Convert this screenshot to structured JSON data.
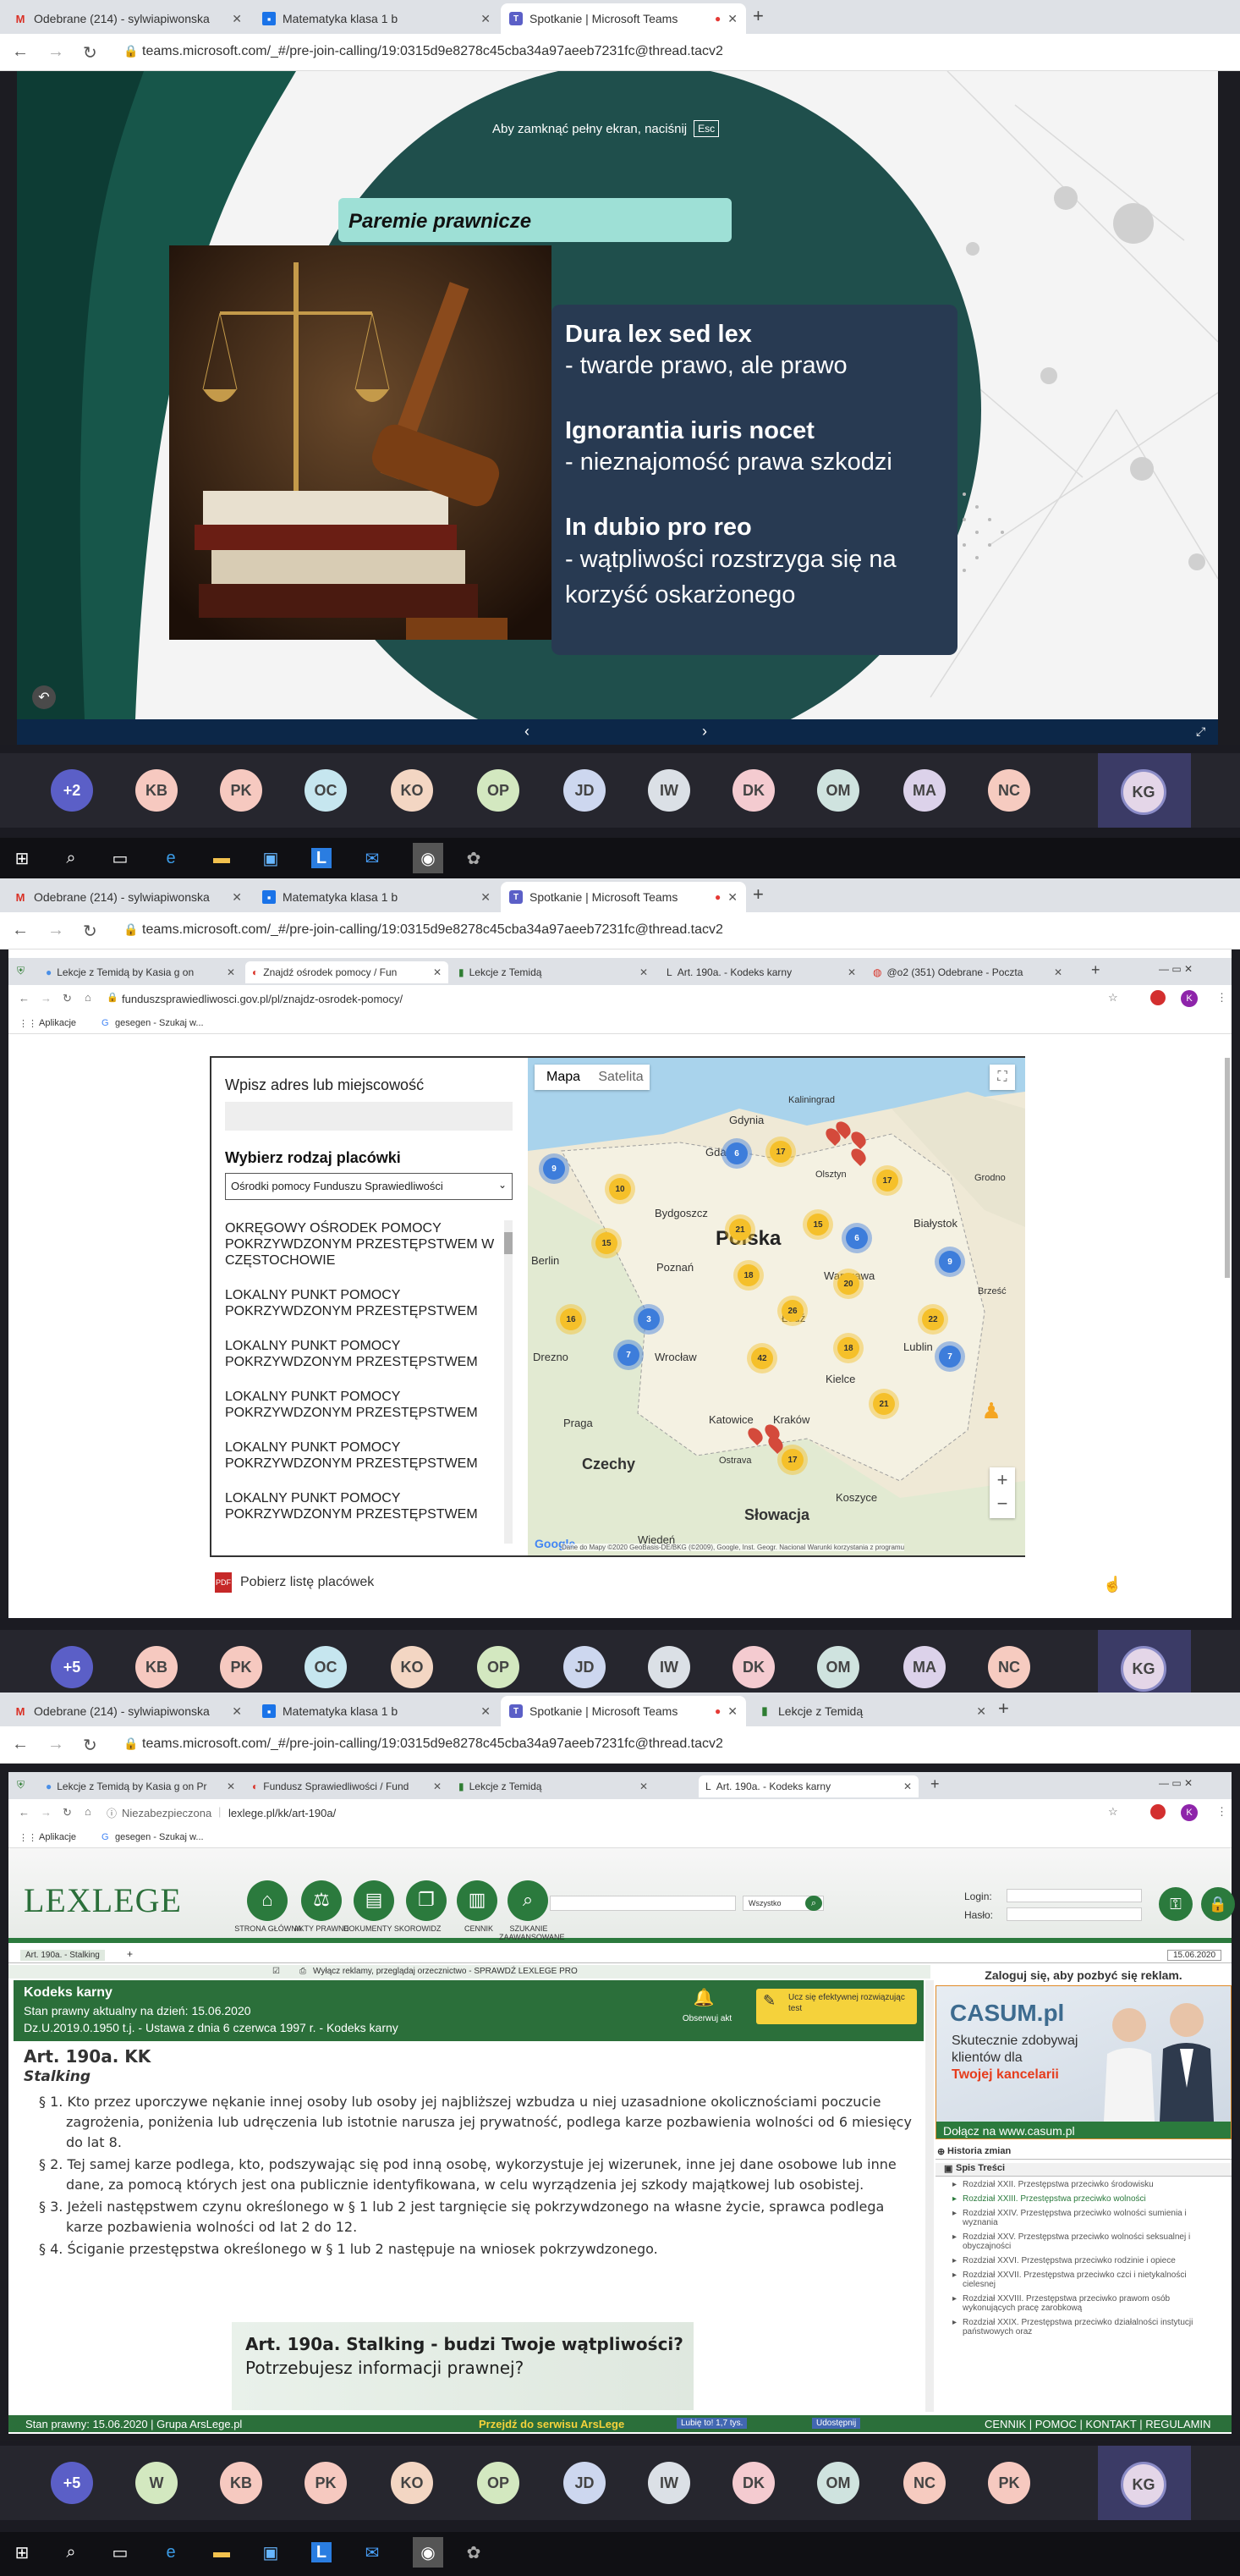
{
  "outer_tabs": [
    {
      "icon": "gmail-icon",
      "label": "Odebrane (214) - sylwiapiwonska",
      "color": "#d93025"
    },
    {
      "icon": "classroom-icon",
      "label": "Matematyka klasa 1 b",
      "color": "#1a73e8"
    },
    {
      "icon": "teams-icon",
      "label": "Spotkanie | Microsoft Teams",
      "color": "#5b5fc7"
    }
  ],
  "outer_tab_extra": "Lekcje z Temidą",
  "url": "teams.microsoft.com/_#/pre-join-calling/19:0315d9e8278c45cba34a97aeeb7231fc@thread.tacv2",
  "fullscreen_hint": {
    "text": "Aby zamknąć pełny ekran, naciśnij",
    "key": "Esc"
  },
  "slide": {
    "title": "Paremie prawnicze",
    "items": [
      {
        "latin": "Dura lex sed lex",
        "pl": "- twarde prawo, ale prawo"
      },
      {
        "latin": "Ignorantia iuris nocet",
        "pl": "- nieznajomość prawa szkodzi"
      },
      {
        "latin": "In dubio pro reo",
        "pl": "- wątpliwości rozstrzyga się na korzyść oskarżonego"
      }
    ]
  },
  "participants_1": [
    "+2",
    "KB",
    "PK",
    "OC",
    "KO",
    "OP",
    "JD",
    "IW",
    "DK",
    "OM",
    "MA",
    "NC"
  ],
  "participants_2": [
    "+5",
    "KB",
    "PK",
    "OC",
    "KO",
    "OP",
    "JD",
    "IW",
    "DK",
    "OM",
    "MA",
    "NC"
  ],
  "participants_3": [
    "+5",
    "W",
    "KB",
    "PK",
    "KO",
    "OP",
    "JD",
    "IW",
    "DK",
    "OM",
    "NC",
    "PK"
  ],
  "self_avatar": "KG",
  "avatar_colors": {
    "+2": "#5b5fc7",
    "+5": "#5b5fc7",
    "KB": "#f6c9c0",
    "PK": "#f6c9c0",
    "OC": "#c6e6ef",
    "KO": "#f3d6c3",
    "OP": "#d3e8c0",
    "JD": "#cdd7ef",
    "IW": "#dbe0e6",
    "DK": "#f4cbd0",
    "OM": "#cfe3df",
    "MA": "#dcd2ea",
    "NC": "#f6cbc0",
    "W": "#d3e8c0"
  },
  "inner_tabs_map": [
    {
      "label": "Lekcje z Temidą by Kasia g on"
    },
    {
      "label": "Znajdź ośrodek pomocy / Fun"
    },
    {
      "label": "Lekcje z Temidą"
    },
    {
      "label": "Art. 190a. - Kodeks karny"
    },
    {
      "label": "@o2 (351) Odebrane - Poczta"
    }
  ],
  "inner_url_map": "funduszsprawiedliwosci.gov.pl/pl/znajdz-osrodek-pomocy/",
  "bookmarks": {
    "apps": "Aplikacje",
    "search": "gesegen - Szukaj w..."
  },
  "map_page": {
    "address_label": "Wpisz adres lub miejscowość",
    "type_label": "Wybierz rodzaj placówki",
    "select_value": "Ośrodki pomocy Funduszu Sprawiedliwości",
    "list": [
      "OKRĘGOWY OŚRODEK POMOCY POKRZYWDZONYM PRZESTĘPSTWEM W CZĘSTOCHOWIE",
      "LOKALNY PUNKT POMOCY POKRZYWDZONYM PRZESTĘPSTWEM",
      "LOKALNY PUNKT POMOCY POKRZYWDZONYM PRZESTĘPSTWEM",
      "LOKALNY PUNKT POMOCY POKRZYWDZONYM PRZESTĘPSTWEM",
      "LOKALNY PUNKT POMOCY POKRZYWDZONYM PRZESTĘPSTWEM",
      "LOKALNY PUNKT POMOCY POKRZYWDZONYM PRZESTĘPSTWEM"
    ],
    "map_tabs": [
      "Mapa",
      "Satelita"
    ],
    "country": "Polska",
    "cities": [
      "Gdynia",
      "Gdańsk",
      "Kaliningrad",
      "Olsztyn",
      "Białystok",
      "Bydgoszcz",
      "Poznań",
      "Warszawa",
      "Berlin",
      "Wrocław",
      "Łódź",
      "Lublin",
      "Drezno",
      "Kielce",
      "Praga",
      "Katowice",
      "Kraków",
      "Ostrava",
      "Czechy",
      "Słowacja",
      "Koszyce",
      "Wiedeń",
      "Grodno",
      "Brześć"
    ],
    "clusters": [
      "9",
      "6",
      "17",
      "17",
      "10",
      "21",
      "15",
      "6",
      "15",
      "18",
      "20",
      "9",
      "26",
      "22",
      "16",
      "3",
      "7",
      "42",
      "18",
      "7",
      "21",
      "17"
    ],
    "footer": "Dane do Mapy ©2020 GeoBasis-DE/BKG (©2009), Google, Inst. Geogr. Nacional   Warunki korzystania z programu",
    "download": "Pobierz listę placówek"
  },
  "inner_tabs_lex": [
    {
      "label": "Lekcje z Temidą by Kasia g on Pr"
    },
    {
      "label": "Fundusz Sprawiedliwości / Fund"
    },
    {
      "label": "Lekcje z Temidą"
    },
    {
      "label": "Art. 190a. - Kodeks karny"
    }
  ],
  "inner_url_lex": {
    "insecure": "Niezabezpieczona",
    "url": "lexlege.pl/kk/art-190a/"
  },
  "lexlege": {
    "logo": "LEXLEGE",
    "nav": [
      "STRONA GŁÓWNA",
      "AKTY PRAWNE",
      "DOKUMENTY SKOROWIDZ",
      "CENNIK",
      "SZUKANIE ZAAWANSOWANE"
    ],
    "search_scope": "Wszystko",
    "login": "Login:",
    "password": "Hasło:",
    "crumb": "Art. 190a. - Stalking",
    "date_box": "15.06.2020",
    "promo": "Wyłącz reklamy, przeglądaj orzecznictwo - SPRAWDŹ LEXLEGE PRO",
    "code_title": "Kodeks karny",
    "state": "Stan prawny aktualny na dzień: 15.06.2020",
    "dz": "Dz.U.2019.0.1950 t.j. - Ustawa z dnia 6 czerwca 1997 r. - Kodeks karny",
    "observe": "Obserwuj akt",
    "learn": "Ucz się efektywnej rozwiązując test",
    "article": "Art. 190a. KK",
    "subtitle": "Stalking",
    "paragraphs": [
      "§ 1. Kto przez uporczywe nękanie innej osoby lub osoby jej najbliższej wzbudza u niej uzasadnione okolicznościami poczucie zagrożenia, poniżenia lub udręczenia lub istotnie narusza jej prywatność, podlega karze pozbawienia wolności od 6 miesięcy do lat 8.",
      "§ 2. Tej samej karze podlega, kto, podszywając się pod inną osobę, wykorzystuje jej wizerunek, inne jej dane osobowe lub inne dane, za pomocą których jest ona publicznie identyfikowana, w celu wyrządzenia jej szkody majątkowej lub osobistej.",
      "§ 3. Jeżeli następstwem czynu określonego w § 1 lub 2 jest targnięcie się pokrzywdzonego na własne życie, sprawca podlega karze pozbawienia wolności od lat 2 do 12.",
      "§ 4. Ściganie przestępstwa określonego w § 1 lub 2 następuje na wniosek pokrzywdzonego."
    ],
    "banner": {
      "line1": "Art. 190a. Stalking - budzi Twoje wątpliwości?",
      "line2": "Potrzebujesz informacji prawnej?"
    },
    "sidebar_login": "Zaloguj się, aby pozbyć się reklam.",
    "ad": {
      "brand": "CASUM.pl",
      "line1": "Skutecznie zdobywaj",
      "line2": "klientów dla",
      "line3": "Twojej kancelarii",
      "link": "Dołącz na www.casum.pl"
    },
    "history": "Historia zmian",
    "toc": "Spis Treści",
    "toc_items": [
      "Rozdział XXII. Przestępstwa przeciwko środowisku",
      "Rozdział XXIII. Przestępstwa przeciwko wolności",
      "Rozdział XXIV. Przestępstwa przeciwko wolności sumienia i wyznania",
      "Rozdział XXV. Przestępstwa przeciwko wolności seksualnej i obyczajności",
      "Rozdział XXVI. Przestępstwa przeciwko rodzinie i opiece",
      "Rozdział XXVII. Przestępstwa przeciwko czci i nietykalności cielesnej",
      "Rozdział XXVIII. Przestępstwa przeciwko prawom osób wykonujących pracę zarobkową",
      "Rozdział XXIX. Przestępstwa przeciwko działalności instytucji państwowych oraz"
    ],
    "footer_state": "Stan prawny: 15.06.2020 | Grupa ArsLege.pl",
    "footer_mid": "Przejdź do serwisu ArsLege",
    "fb_like": "Lubię to! 1,7 tys.",
    "fb_share": "Udostępnij",
    "footer_links": "CENNIK | POMOC | KONTAKT | REGULAMIN"
  }
}
